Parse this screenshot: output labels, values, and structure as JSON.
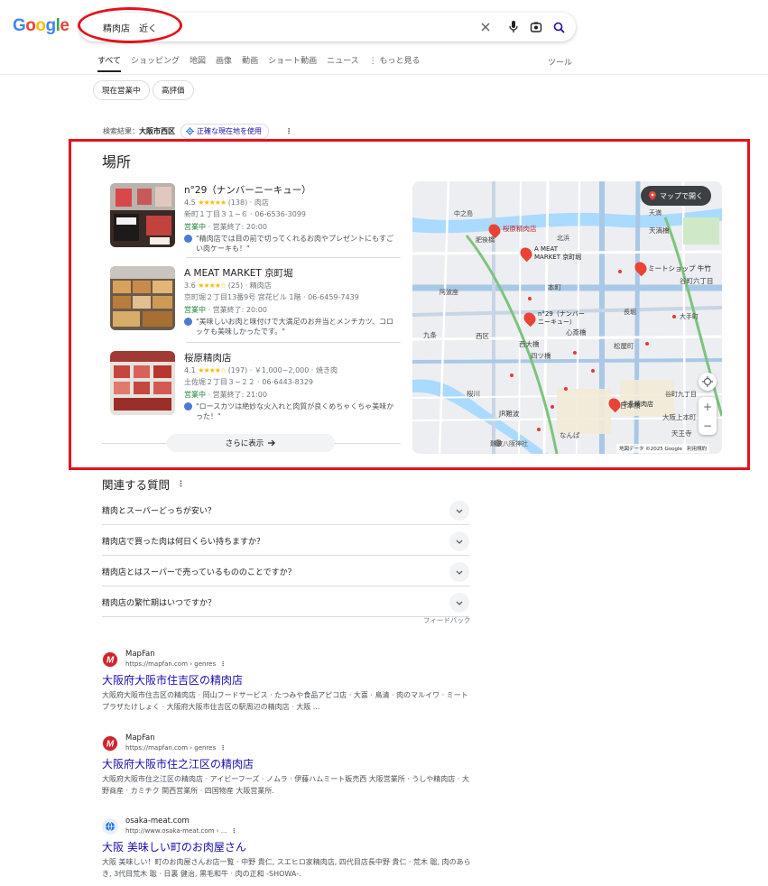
{
  "logo": "Google",
  "search": {
    "query": "精肉店　近く",
    "clear_icon": "close-icon",
    "voice_icon": "mic-icon",
    "lens_icon": "camera-lens-icon",
    "search_icon": "search-icon"
  },
  "tabs": [
    "すべて",
    "ショッピング",
    "地図",
    "画像",
    "動画",
    "ショート動画",
    "ニュース",
    "⋮ もっと見る"
  ],
  "tools": "ツール",
  "chips": [
    "現在営業中",
    "高評価"
  ],
  "location": {
    "label": "検索結果：",
    "area": "大阪市西区",
    "precise_button": "正確な現在地を使用"
  },
  "places": {
    "heading": "場所",
    "items": [
      {
        "name": "n°29（ナンバーニーキュー）",
        "rating": "4.5",
        "stars": "★★★★★",
        "meta": "(138) · 肉店",
        "address": "新町１丁目３１−６ · 06-6536-3099",
        "open": "営業中",
        "hours": " · 営業終了: 20:00",
        "review": "\"精肉店では目の前で切ってくれるお肉やプレゼントにもすごい肉ケーキも！\""
      },
      {
        "name": "A MEAT MARKET 京町堀",
        "rating": "3.6",
        "stars": "★★★★☆",
        "meta": "(25) · 精肉店",
        "address": "京町堀２丁目13番9号 宮花ビル 1階 · 06-6459-7439",
        "open": "営業中",
        "hours": " · 営業終了: 20:00",
        "review": "\"美味しいお肉と味付けで大満足のお弁当とメンチカツ、コロッケも美味しかったです。\""
      },
      {
        "name": "桜原精肉店",
        "rating": "4.1",
        "stars": "★★★★☆",
        "meta": "(197) · ￥1,000~2,000 · 焼き肉",
        "address": "土佐堀２丁目３−２２ · 06-6443-8329",
        "open": "営業中",
        "hours": " · 営業終了: 21:00",
        "review": "\"ロースカツは絶妙な火入れと肉質が良くめちゃくちゃ美味かった！\""
      }
    ],
    "more_button": "さらに表示",
    "map_button": "マップで開く",
    "map_labels": {
      "pin1": "桜原精肉店",
      "pin2a": "A MEAT",
      "pin2b": "MARKET 京町堀",
      "pin3a": "n°29（ナンバー",
      "pin3b": "ニーキュー）",
      "pin4": "ミートショップ 牛竹",
      "pin5": "中条精肉店",
      "area1": "中之島",
      "area2": "天満橋",
      "area3": "谷町六丁目",
      "area4": "松屋町",
      "area5": "日本橋",
      "area6": "なんば",
      "area7": "大阪上本町",
      "area8": "天王寺",
      "area9": "西区",
      "area10": "西大橋",
      "area11": "四ツ橋",
      "area12": "心斎橋",
      "area13": "本町",
      "area14": "九条",
      "area15": "桜川",
      "area16": "JR難波",
      "area17": "阿波座",
      "area18": "難波八阪神社",
      "area19": "谷町九丁目",
      "area20": "肥後橋",
      "area21": "天満",
      "area22": "大手町",
      "area23": "長堀",
      "area24": "北浜",
      "credit": "地図データ ©2025 Google",
      "terms": "利用規約"
    }
  },
  "paa": {
    "heading": "関連する質問",
    "questions": [
      "精肉とスーパーどっちが安い？",
      "精肉店で買った肉は何日くらい持ちますか？",
      "精肉店とはスーパーで売っているもののことですか？",
      "精肉店の繁忙期はいつですか？"
    ],
    "feedback": "フィードバック"
  },
  "results": [
    {
      "site": "MapFan",
      "url": "https://mapfan.com › genres",
      "title": "大阪府大阪市住吉区の精肉店",
      "snippet": "大阪府大阪市住吉区の精肉店 · 岡山フードサービス · たつみや食品アピコ店 · 大喜 · 鳥清 · 肉のマルイワ · ミートプラザたけしょく · 大阪府大阪市住吉区の駅周辺の精肉店 · 大阪 ...",
      "favicon_color": "#d2232a"
    },
    {
      "site": "MapFan",
      "url": "https://mapfan.com › genres",
      "title": "大阪府大阪市住之江区の精肉店",
      "snippet": "大阪府大阪市住之江区の精肉店 · アイビーフーズ · ノムラ · 伊藤ハムミート販売西 大阪営業所 · うしや精肉店 · 大野商産 · カミチク 関西営業所 · 四国物産 大阪営業所.",
      "favicon_color": "#d2232a"
    },
    {
      "site": "osaka-meat.com",
      "url": "http://www.osaka-meat.com › ...",
      "title": "大阪 美味しい町のお肉屋さん",
      "snippet": "大阪 美味しい！町のお肉屋さんお店一覧 · 中野 貴仁, スエヒロ家精肉店, 四代目店長中野 貴仁 · 荒木 聡, 肉のあらき, 3代目荒木 聡 · 日裏 健治, 黒毛和牛 · 肉の正和 -SHOWA-.",
      "favicon_color": "#1a73e8"
    }
  ]
}
